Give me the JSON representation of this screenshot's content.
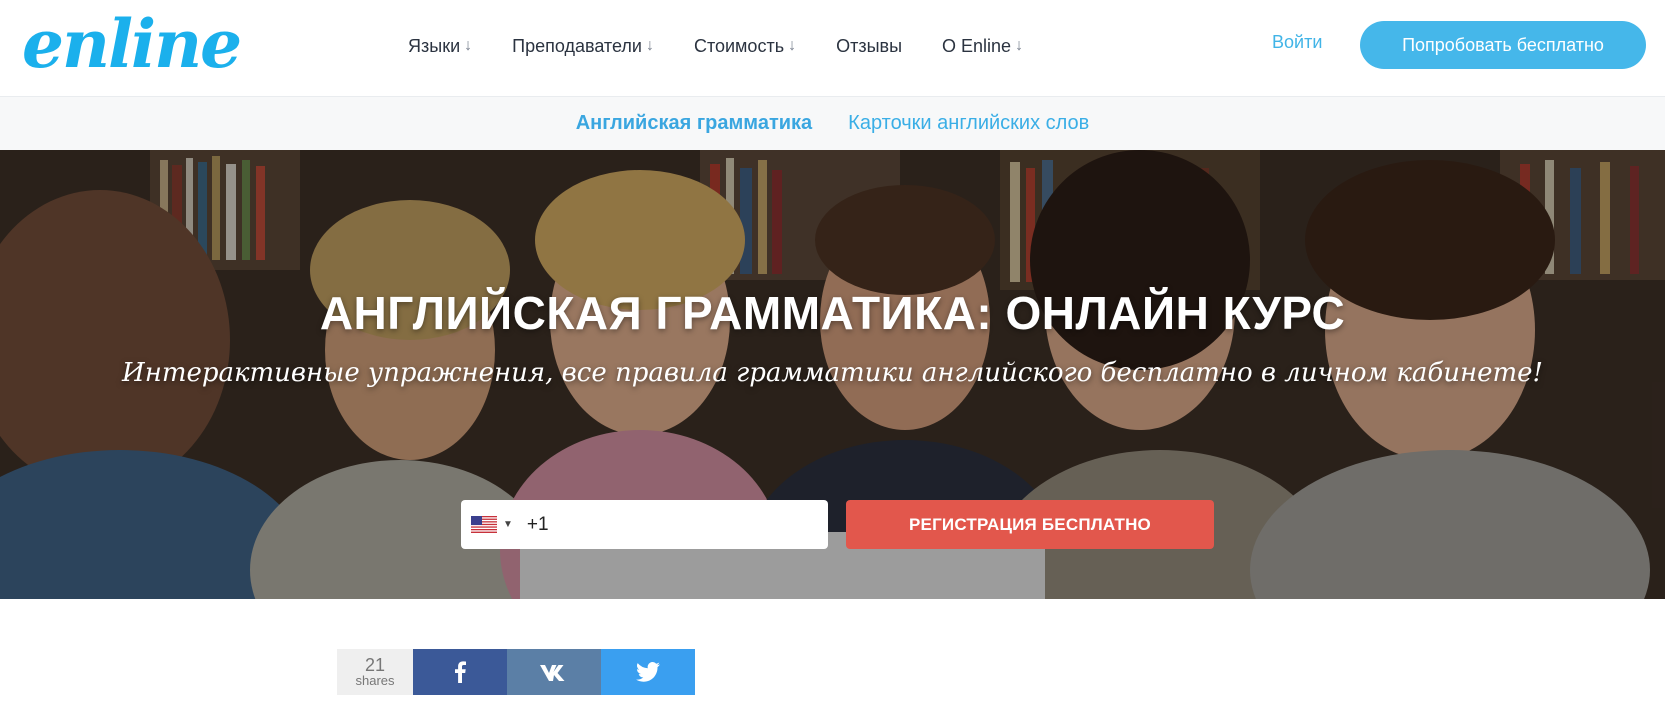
{
  "header": {
    "logo_text": "enline",
    "nav": [
      {
        "label": "Языки",
        "has_arrow": true
      },
      {
        "label": "Преподаватели",
        "has_arrow": true
      },
      {
        "label": "Стоимость",
        "has_arrow": true
      },
      {
        "label": "Отзывы",
        "has_arrow": false
      },
      {
        "label": "О Enline",
        "has_arrow": true
      }
    ],
    "arrow_glyph": "↓",
    "login_label": "Войти",
    "try_label": "Попробовать бесплатно"
  },
  "subnav": {
    "items": [
      {
        "label": "Английская грамматика",
        "active": true
      },
      {
        "label": "Карточки английских слов",
        "active": false
      }
    ]
  },
  "hero": {
    "title": "АНГЛИЙСКАЯ ГРАММАТИКА: ОНЛАЙН КУРС",
    "subtitle": "Интерактивные упражнения, все правила грамматики английского бесплатно в личном кабинете!",
    "phone": {
      "country_icon": "us-flag-icon",
      "value": "+1"
    },
    "register_label": "РЕГИСТРАЦИЯ БЕСПЛАТНО"
  },
  "share": {
    "count": "21",
    "count_label": "shares",
    "buttons": [
      {
        "name": "facebook",
        "icon": "facebook-icon",
        "color": "#3b5998"
      },
      {
        "name": "vk",
        "icon": "vk-icon",
        "color": "#5b7fa6"
      },
      {
        "name": "twitter",
        "icon": "twitter-icon",
        "color": "#3a9ff0"
      }
    ]
  },
  "colors": {
    "brand": "#1bb0ec",
    "accent_button": "#45b7ea",
    "register_button": "#e2574c"
  }
}
